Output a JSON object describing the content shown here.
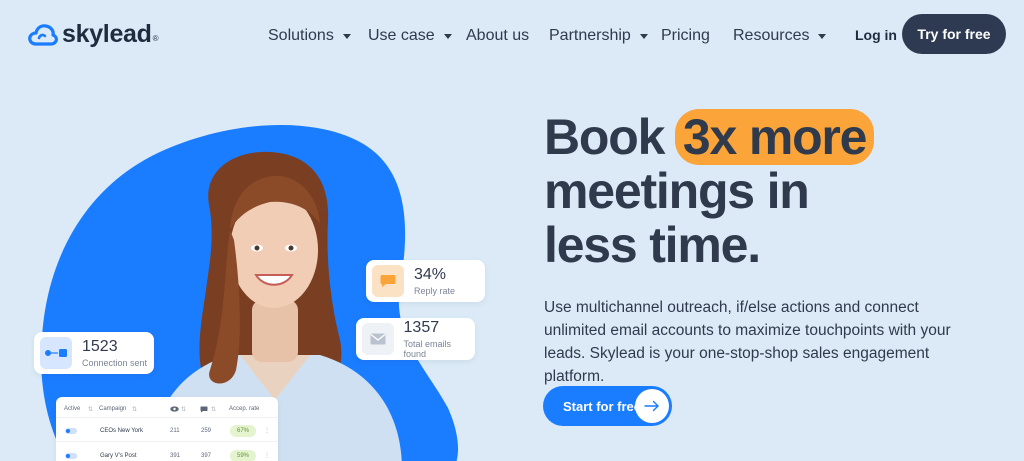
{
  "brand": {
    "name": "skylead",
    "reg": "®",
    "accent": "#1a7cff"
  },
  "nav": {
    "items": [
      {
        "label": "Solutions",
        "dropdown": true
      },
      {
        "label": "Use case",
        "dropdown": true
      },
      {
        "label": "About us",
        "dropdown": false
      },
      {
        "label": "Partnership",
        "dropdown": true
      },
      {
        "label": "Pricing",
        "dropdown": false
      },
      {
        "label": "Resources",
        "dropdown": true
      }
    ],
    "login": "Log in",
    "cta": "Try for free"
  },
  "hero": {
    "headline_before": "Book ",
    "headline_highlight": "3x more",
    "headline_line2": "meetings in",
    "headline_line3": "less time.",
    "description": "Use multichannel outreach, if/else actions and connect unlimited email accounts to maximize touchpoints with your leads. Skylead is your one-stop-shop sales engagement platform.",
    "cta": "Start for free"
  },
  "stats": {
    "reply": {
      "value": "34%",
      "label": "Reply rate"
    },
    "connections": {
      "value": "1523",
      "label": "Connection sent"
    },
    "emails": {
      "value": "1357",
      "label": "Total emails found"
    }
  },
  "campaign_table": {
    "headers": [
      "Active",
      "Campaign",
      "Accep. rate"
    ],
    "rows": [
      {
        "campaign": "CEOs New York",
        "views": "211",
        "replies": "259",
        "rate": "67%"
      },
      {
        "campaign": "Gary V's Post",
        "views": "391",
        "replies": "397",
        "rate": "59%"
      }
    ]
  }
}
